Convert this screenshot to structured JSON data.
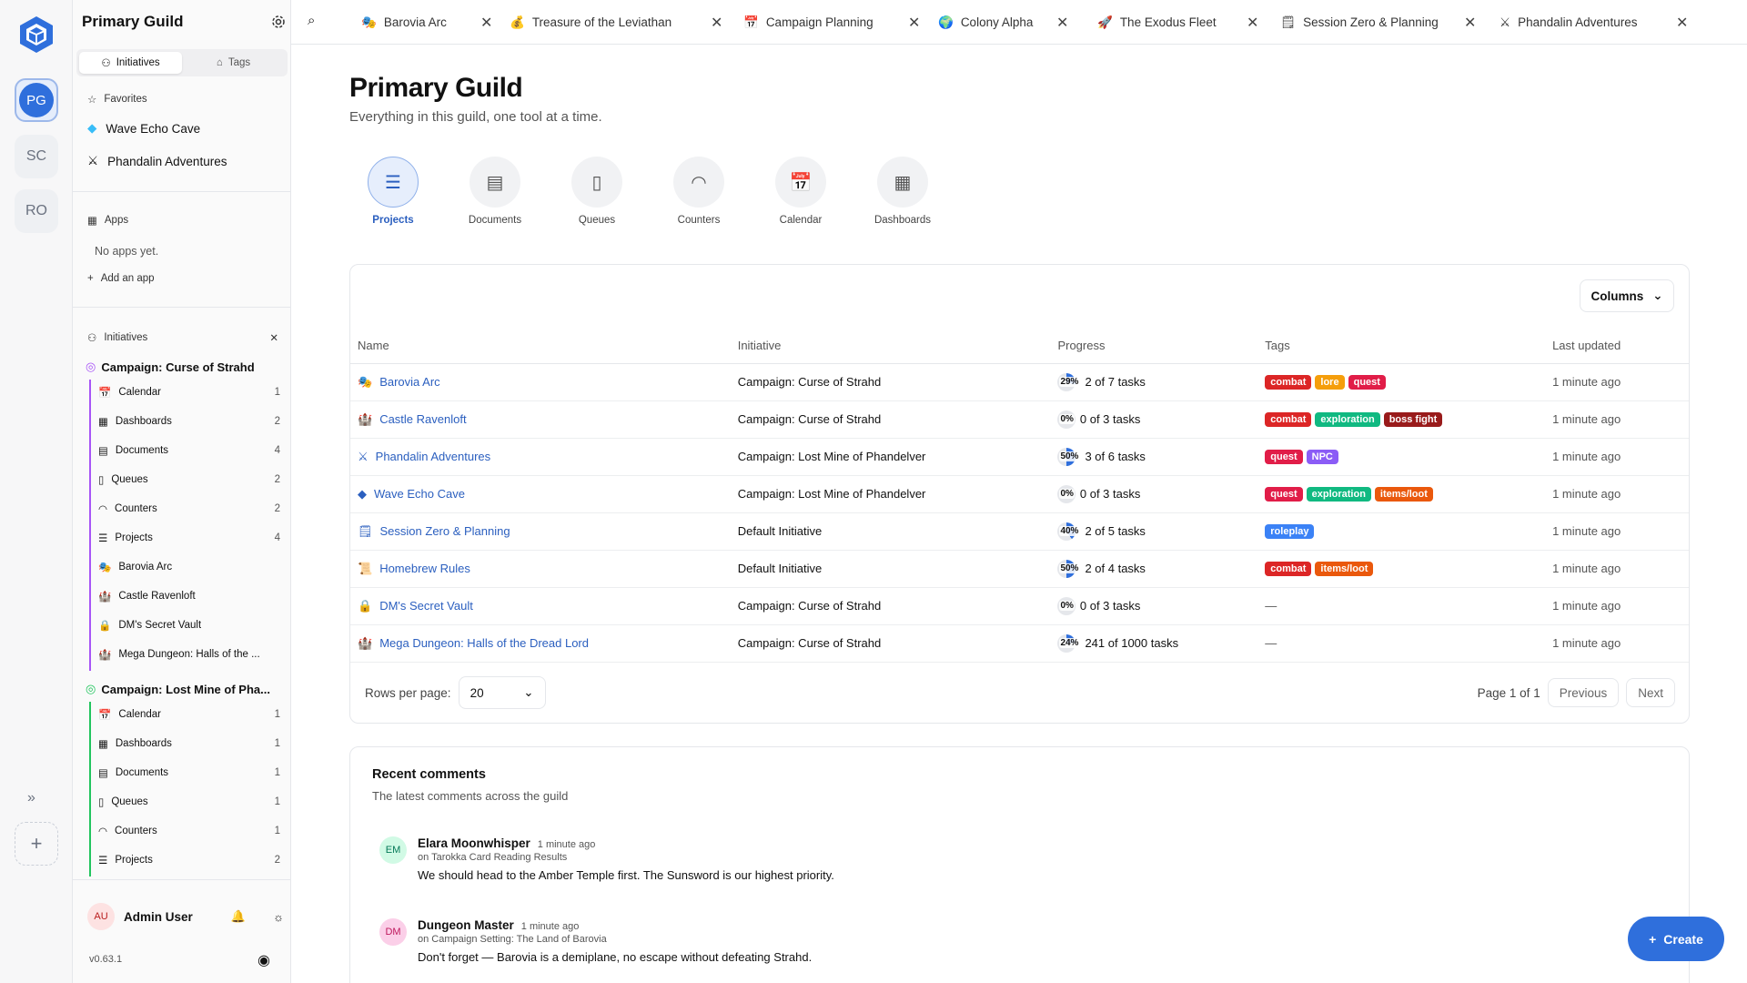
{
  "rail": {
    "workspaces": [
      {
        "label": "PG",
        "active": true
      },
      {
        "label": "SC"
      },
      {
        "label": "RO"
      }
    ]
  },
  "sidebar": {
    "title": "Primary Guild",
    "tabs": [
      "Initiatives",
      "Tags"
    ],
    "favorites_label": "Favorites",
    "favorites": [
      {
        "label": "Wave Echo Cave",
        "icon": "gem-icon"
      },
      {
        "label": "Phandalin Adventures",
        "icon": "swords-icon"
      }
    ],
    "apps_label": "Apps",
    "no_apps": "No apps yet.",
    "add_app": "Add an app",
    "initiatives_label": "Initiatives",
    "initiatives": [
      {
        "title": "Campaign: Curse of Strahd",
        "color": "#a855f7",
        "items": [
          {
            "label": "Calendar",
            "count": "1",
            "icon": "calendar-icon"
          },
          {
            "label": "Dashboards",
            "count": "2",
            "icon": "dashboard-icon"
          },
          {
            "label": "Documents",
            "count": "4",
            "icon": "document-icon"
          },
          {
            "label": "Queues",
            "count": "2",
            "icon": "queue-icon"
          },
          {
            "label": "Counters",
            "count": "2",
            "icon": "gauge-icon"
          },
          {
            "label": "Projects",
            "count": "4",
            "icon": "projects-icon"
          },
          {
            "label": "Barovia Arc",
            "count": "",
            "icon": "mask-icon"
          },
          {
            "label": "Castle Ravenloft",
            "count": "",
            "icon": "castle-icon"
          },
          {
            "label": "DM's Secret Vault",
            "count": "",
            "icon": "lock-icon"
          },
          {
            "label": "Mega Dungeon: Halls of the ...",
            "count": "",
            "icon": "castle-icon"
          }
        ]
      },
      {
        "title": "Campaign: Lost Mine of Pha...",
        "color": "#22c55e",
        "items": [
          {
            "label": "Calendar",
            "count": "1",
            "icon": "calendar-icon"
          },
          {
            "label": "Dashboards",
            "count": "1",
            "icon": "dashboard-icon"
          },
          {
            "label": "Documents",
            "count": "1",
            "icon": "document-icon"
          },
          {
            "label": "Queues",
            "count": "1",
            "icon": "queue-icon"
          },
          {
            "label": "Counters",
            "count": "1",
            "icon": "gauge-icon"
          },
          {
            "label": "Projects",
            "count": "2",
            "icon": "projects-icon"
          }
        ]
      }
    ],
    "user": {
      "initials": "AU",
      "name": "Admin User"
    },
    "version": "v0.63.1"
  },
  "tabs": [
    {
      "label": "Barovia Arc",
      "icon": "mask-icon"
    },
    {
      "label": "Treasure of the Leviathan",
      "icon": "moneybag-icon"
    },
    {
      "label": "Campaign Planning",
      "icon": "calendar-icon"
    },
    {
      "label": "Colony Alpha",
      "icon": "globe-icon"
    },
    {
      "label": "The Exodus Fleet",
      "icon": "rocket-icon"
    },
    {
      "label": "Session Zero & Planning",
      "icon": "notepad-icon"
    },
    {
      "label": "Phandalin Adventures",
      "icon": "swords-icon"
    }
  ],
  "main": {
    "title": "Primary Guild",
    "subtitle": "Everything in this guild, one tool at a time.",
    "tools": [
      "Projects",
      "Documents",
      "Queues",
      "Counters",
      "Calendar",
      "Dashboards"
    ],
    "columns_button": "Columns",
    "table": {
      "headers": [
        "Name",
        "Initiative",
        "Progress",
        "Tags",
        "Last updated"
      ],
      "rows": [
        {
          "name": "Barovia Arc",
          "icon": "mask-icon",
          "initiative": "Campaign: Curse of Strahd",
          "pct": "29%",
          "progress": 0.29,
          "tasks": "2 of 7 tasks",
          "tags": [
            "combat",
            "lore",
            "quest"
          ],
          "updated": "1 minute ago"
        },
        {
          "name": "Castle Ravenloft",
          "icon": "castle-icon",
          "initiative": "Campaign: Curse of Strahd",
          "pct": "0%",
          "progress": 0,
          "tasks": "0 of 3 tasks",
          "tags": [
            "combat",
            "exploration",
            "boss fight"
          ],
          "updated": "1 minute ago"
        },
        {
          "name": "Phandalin Adventures",
          "icon": "swords-icon",
          "initiative": "Campaign: Lost Mine of Phandelver",
          "pct": "50%",
          "progress": 0.5,
          "tasks": "3 of 6 tasks",
          "tags": [
            "quest",
            "NPC"
          ],
          "updated": "1 minute ago"
        },
        {
          "name": "Wave Echo Cave",
          "icon": "gem-icon",
          "initiative": "Campaign: Lost Mine of Phandelver",
          "pct": "0%",
          "progress": 0,
          "tasks": "0 of 3 tasks",
          "tags": [
            "quest",
            "exploration",
            "items/loot"
          ],
          "updated": "1 minute ago"
        },
        {
          "name": "Session Zero & Planning",
          "icon": "notepad-icon",
          "initiative": "Default Initiative",
          "pct": "40%",
          "progress": 0.4,
          "tasks": "2 of 5 tasks",
          "tags": [
            "roleplay"
          ],
          "updated": "1 minute ago"
        },
        {
          "name": "Homebrew Rules",
          "icon": "scroll-icon",
          "initiative": "Default Initiative",
          "pct": "50%",
          "progress": 0.5,
          "tasks": "2 of 4 tasks",
          "tags": [
            "combat",
            "items/loot"
          ],
          "updated": "1 minute ago"
        },
        {
          "name": "DM's Secret Vault",
          "icon": "lock-icon",
          "initiative": "Campaign: Curse of Strahd",
          "pct": "0%",
          "progress": 0,
          "tasks": "0 of 3 tasks",
          "tags": [],
          "updated": "1 minute ago"
        },
        {
          "name": "Mega Dungeon: Halls of the Dread Lord",
          "icon": "castle-icon",
          "initiative": "Campaign: Curse of Strahd",
          "pct": "24%",
          "progress": 0.241,
          "tasks": "241 of 1000 tasks",
          "tags": [],
          "updated": "1 minute ago"
        }
      ],
      "empty_tags": "—",
      "tag_colors": {
        "combat": "#dc2626",
        "lore": "#f59e0b",
        "quest": "#e11d48",
        "exploration": "#10b981",
        "boss fight": "#991b1b",
        "NPC": "#8b5cf6",
        "items/loot": "#ea580c",
        "roleplay": "#3b82f6"
      }
    },
    "rows_per_page_label": "Rows per page:",
    "rows_per_page": "20",
    "page_info": "Page 1 of 1",
    "prev": "Previous",
    "next": "Next",
    "comments": {
      "title": "Recent comments",
      "subtitle": "The latest comments across the guild",
      "items": [
        {
          "initials": "EM",
          "author": "Elara Moonwhisper",
          "time": "1 minute ago",
          "context": "on Tarokka Card Reading Results",
          "text": "We should head to the Amber Temple first. The Sunsword is our highest priority.",
          "bg": "#d1fae5",
          "fg": "#047857"
        },
        {
          "initials": "DM",
          "author": "Dungeon Master",
          "time": "1 minute ago",
          "context": "on Campaign Setting: The Land of Barovia",
          "text": "Don't forget — Barovia is a demiplane, no escape without defeating Strahd.",
          "bg": "#fbcfe8",
          "fg": "#be185d"
        }
      ]
    },
    "create": "Create"
  }
}
